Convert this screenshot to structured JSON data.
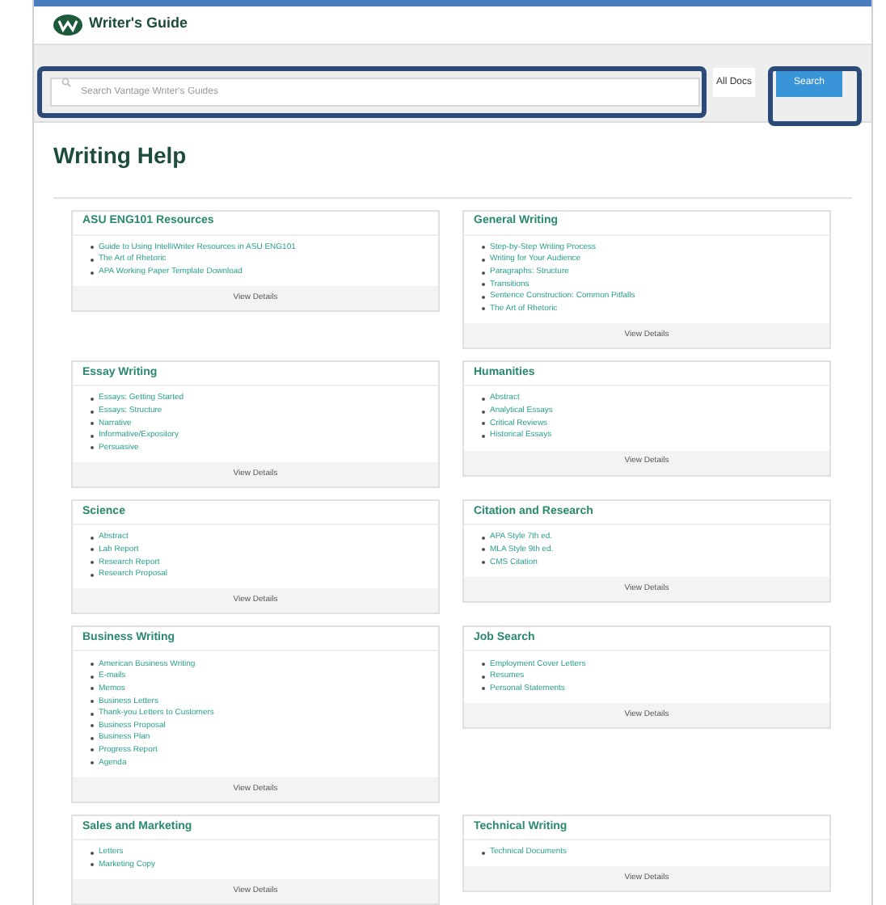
{
  "header": {
    "logo_text": "Writer's Guide"
  },
  "search": {
    "placeholder": "Search Vantage Writer's Guides",
    "scope": "All Docs",
    "button": "Search"
  },
  "heading": "Writing Help",
  "sections": [
    {
      "title": "ASU ENG101 Resources",
      "links": [
        "Guide to Using IntelliWriter Resources in ASU ENG101",
        "The Art of Rhetoric",
        "APA Working Paper Template Download"
      ],
      "action": "View Details"
    },
    {
      "title": "General Writing",
      "links": [
        "Step-by-Step Writing Process",
        "Writing for Your Audience",
        "Paragraphs: Structure",
        "Transitions",
        "Sentence Construction: Common Pitfalls",
        "The Art of Rhetoric"
      ],
      "action": "View Details"
    },
    {
      "title": "Essay Writing",
      "links": [
        "Essays: Getting Started",
        "Essays: Structure",
        "Narrative",
        "Informative/Expository",
        "Persuasive"
      ],
      "action": "View Details"
    },
    {
      "title": "Humanities",
      "links": [
        "Abstract",
        "Analytical Essays",
        "Critical Reviews",
        "Historical Essays"
      ],
      "action": "View Details"
    },
    {
      "title": "Science",
      "links": [
        "Abstract",
        "Lab Report",
        "Research Report",
        "Research Proposal"
      ],
      "action": "View Details"
    },
    {
      "title": "Citation and Research",
      "links": [
        "APA Style 7th ed.",
        "MLA Style 9th ed.",
        "CMS Citation"
      ],
      "action": "View Details"
    },
    {
      "title": "Business Writing",
      "links": [
        "American Business Writing",
        "E-mails",
        "Memos",
        "Business Letters",
        "Thank-you Letters to Customers",
        "Business Proposal",
        "Business Plan",
        "Progress Report",
        "Agenda"
      ],
      "action": "View Details"
    },
    {
      "title": "Job Search",
      "links": [
        "Employment Cover Letters",
        "Resumes",
        "Personal Statements"
      ],
      "action": "View Details"
    },
    {
      "title": "Sales and Marketing",
      "links": [
        "Letters",
        "Marketing Copy"
      ],
      "action": "View Details"
    },
    {
      "title": "Technical Writing",
      "links": [
        "Technical Documents"
      ],
      "action": "View Details"
    }
  ]
}
